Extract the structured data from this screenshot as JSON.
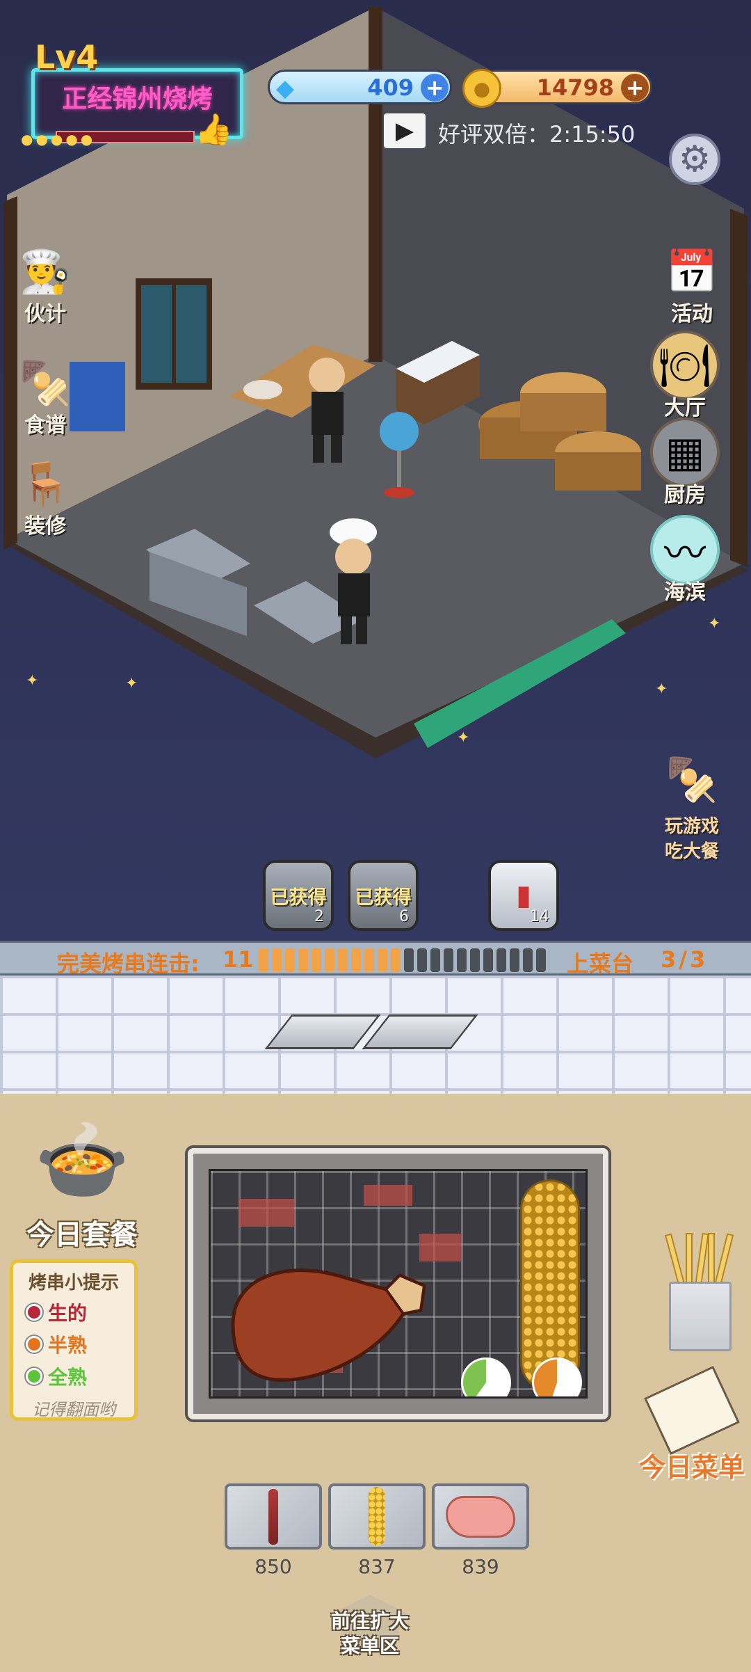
{
  "header": {
    "level": "Lv4",
    "shop_name": "正经锦州烧烤",
    "gems": "409",
    "coins": "14798",
    "video_bonus_label": "好评双倍：2:15:50"
  },
  "left_menu": {
    "staff": "伙计",
    "recipes": "食谱",
    "decor": "装修"
  },
  "right_menu": {
    "activity": "活动",
    "hall": "大厅",
    "kitchen": "厨房",
    "seaside": "海滨"
  },
  "promo": {
    "line1": "玩游戏",
    "line2": "吃大餐"
  },
  "tiles": [
    {
      "label": "已获得",
      "count": "2"
    },
    {
      "label": "已获得",
      "count": "6"
    },
    {
      "label": "",
      "count": "14"
    }
  ],
  "combo": {
    "label": "完美烤串连击:",
    "value": "11",
    "filled_segments": 11,
    "total_segments": 22,
    "counter_label": "上菜台",
    "counter_value": "3/3"
  },
  "combo_meal_label": "今日套餐",
  "tips": {
    "title": "烤串小提示",
    "raw": "生的",
    "medium": "半熟",
    "done": "全熟",
    "footer": "记得翻面哟"
  },
  "menu_today_label": "今日菜单",
  "inventory": [
    {
      "item": "skewer",
      "qty": "850"
    },
    {
      "item": "corn",
      "qty": "837"
    },
    {
      "item": "drumstick",
      "qty": "839"
    }
  ],
  "expand_button": {
    "line1": "前往扩大",
    "line2": "菜单区"
  },
  "colors": {
    "accent_orange": "#e67a1f",
    "neon_pink": "#ff5ec8",
    "neon_cyan": "#5ee5e8"
  }
}
